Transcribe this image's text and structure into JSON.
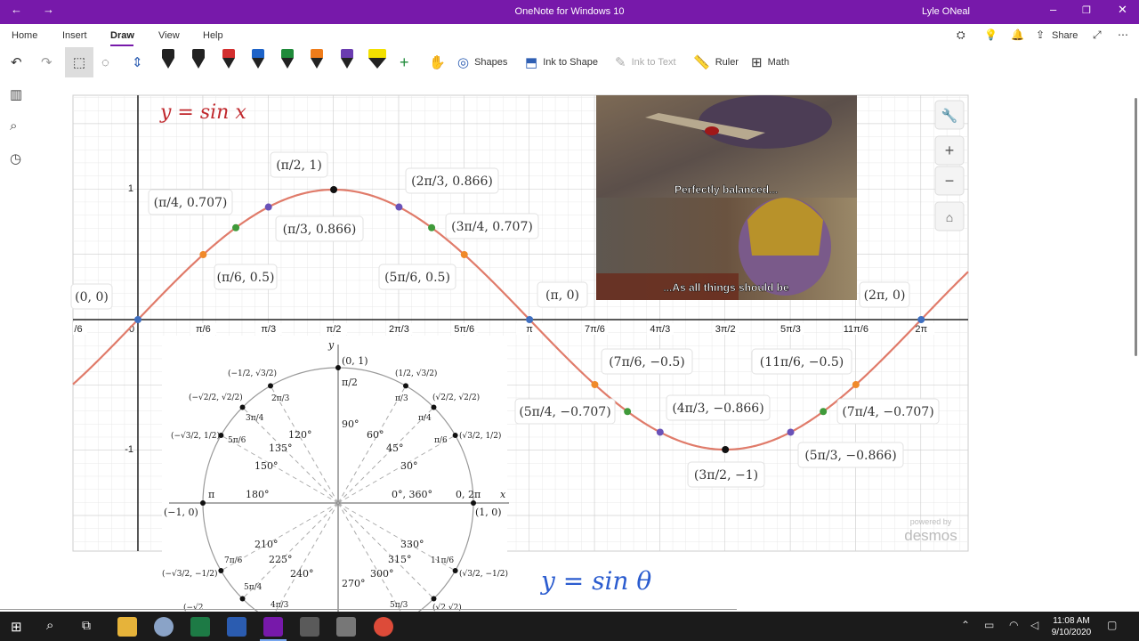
{
  "app": {
    "title": "OneNote for Windows 10",
    "user": "Lyle ONeal"
  },
  "menu": {
    "tabs": [
      "Home",
      "Insert",
      "Draw",
      "View",
      "Help"
    ],
    "active_tab": "Draw",
    "share_label": "Share"
  },
  "toolbar": {
    "shapes": "Shapes",
    "ink_to_shape": "Ink to Shape",
    "ink_to_text": "Ink to Text",
    "ruler": "Ruler",
    "math": "Math",
    "pen_colors": [
      "#222222",
      "#222222",
      "#d32f2f",
      "#1e63c8",
      "#1f8a3a",
      "#ef7c1a",
      "#6a3cb0",
      "#f2e000"
    ],
    "icons": [
      "undo-icon",
      "redo-icon",
      "lasso-select-icon",
      "lasso-icon",
      "add-space-icon",
      "add-pen-icon",
      "eraser-icon",
      "shapes-icon",
      "ink-to-shape-icon",
      "ink-to-text-icon",
      "ruler-icon",
      "math-icon"
    ]
  },
  "graph": {
    "equation": "y = sin x",
    "watermark_top": "powered by",
    "watermark": "desmos",
    "x_ticks": [
      "π/6",
      "π/3",
      "π/2",
      "2π/3",
      "5π/6",
      "π",
      "7π/6",
      "4π/3",
      "3π/2",
      "5π/3",
      "11π/6",
      "2π"
    ],
    "x_tick_left": "/6",
    "origin_label": "0",
    "y_ticks": [
      "1",
      "-1"
    ],
    "point_labels": [
      "(0, 0)",
      "(π/4, 0.707)",
      "(π/2, 1)",
      "(2π/3, 0.866)",
      "(π/6, 0.5)",
      "(π/3, 0.866)",
      "(5π/6, 0.5)",
      "(3π/4, 0.707)",
      "(π, 0)",
      "(2π, 0)",
      "(7π/6, −0.5)",
      "(11π/6, −0.5)",
      "(5π/4, −0.707)",
      "(4π/3, −0.866)",
      "(7π/4, −0.707)",
      "(3π/2, −1)",
      "(5π/3, −0.866)"
    ],
    "colors": {
      "curve": "#e07b6a",
      "black_point": "#111111",
      "orange_point": "#f0892a",
      "green_point": "#3f9a3a",
      "purple_point": "#6a52b8",
      "blue_point": "#3f6fc0"
    }
  },
  "meme": {
    "top_caption": "Perfectly balanced...",
    "bottom_caption": "...As all things should be"
  },
  "unit_circle": {
    "axis_x": "x",
    "axis_y": "y",
    "top_point": "(0, 1)",
    "top_angle": "π/2",
    "deg_90": "90°",
    "deg_120": "120°",
    "deg_135": "135°",
    "deg_150": "150°",
    "deg_180": "180°",
    "deg_60": "60°",
    "deg_45": "45°",
    "deg_30": "30°",
    "deg_0": "0°, 360°",
    "deg_210": "210°",
    "deg_225": "225°",
    "deg_240": "240°",
    "deg_270": "270°",
    "deg_300": "300°",
    "deg_315": "315°",
    "deg_330": "330°",
    "angle_0": "0, 2π",
    "angle_pi": "π",
    "right_point": "(1, 0)",
    "left_point": "(−1, 0)",
    "a_2pi3": "2π/3",
    "a_3pi4": "3π/4",
    "a_5pi6": "5π/6",
    "a_pi3": "π/3",
    "a_pi4": "π/4",
    "a_pi6": "π/6",
    "a_7pi6": "7π/6",
    "a_5pi4": "5π/4",
    "a_4pi3": "4π/3",
    "a_11pi6": "11π/6",
    "a_5pi3": "5π/3",
    "c_120": "(−1/2, √3/2)",
    "c_135": "(−√2/2, √2/2)",
    "c_150": "(−√3/2, 1/2)",
    "c_60": "(1/2, √3/2)",
    "c_45": "(√2/2, √2/2)",
    "c_30": "(√3/2, 1/2)",
    "c_210": "(−√3/2, −1/2)",
    "c_330": "(√3/2, −1/2)",
    "c_225_partial": "(−√2",
    "c_315_partial": "(√2  √2)"
  },
  "handwriting": "y = sin θ",
  "taskbar": {
    "time": "11:08 AM",
    "date": "9/10/2020"
  }
}
